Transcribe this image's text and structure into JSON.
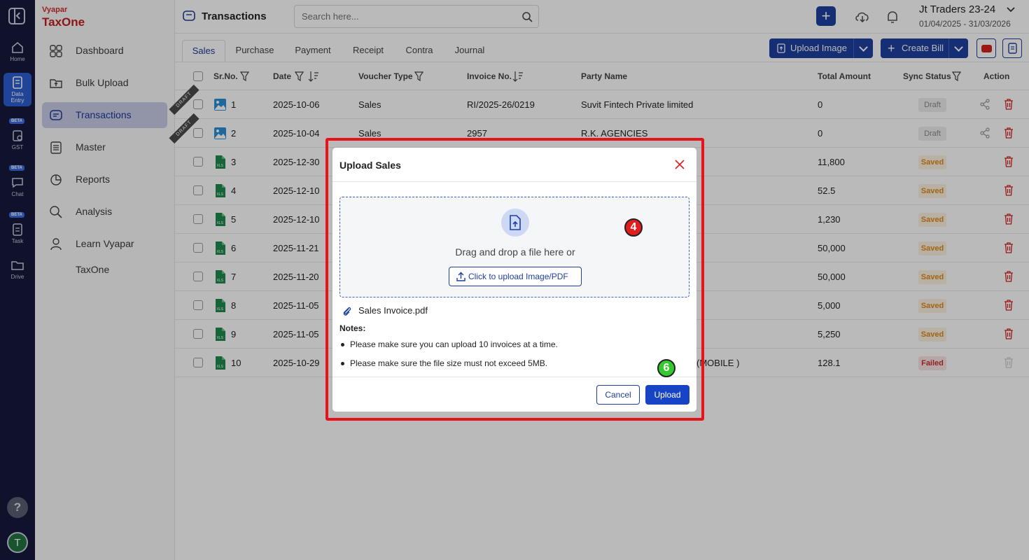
{
  "app": {
    "logo_line1": "Vyapar",
    "logo_line2": "TaxOne"
  },
  "rail": {
    "items": [
      {
        "label": "Home",
        "icon": "home-icon"
      },
      {
        "label": "Data Entry",
        "icon": "data-entry-icon",
        "active": true
      },
      {
        "label": "GST",
        "icon": "gst-icon",
        "badge": "BETA"
      },
      {
        "label": "Chat",
        "icon": "chat-icon",
        "badge": "BETA"
      },
      {
        "label": "Task",
        "icon": "task-icon",
        "badge": "BETA"
      },
      {
        "label": "Drive",
        "icon": "drive-icon"
      }
    ],
    "help": "?",
    "avatar": "T"
  },
  "sidebar": {
    "items": [
      {
        "label": "Dashboard",
        "icon": "dashboard-icon"
      },
      {
        "label": "Bulk Upload",
        "icon": "bulk-upload-icon"
      },
      {
        "label": "Transactions",
        "icon": "transactions-icon",
        "active": true
      },
      {
        "label": "Master",
        "icon": "master-icon"
      },
      {
        "label": "Reports",
        "icon": "reports-icon"
      },
      {
        "label": "Analysis",
        "icon": "analysis-icon"
      },
      {
        "label": "Learn Vyapar TaxOne",
        "icon": "learn-icon"
      }
    ]
  },
  "header": {
    "title": "Transactions",
    "search_placeholder": "Search here...",
    "company": "Jt Traders 23-24",
    "period": "01/04/2025 - 31/03/2026",
    "new_label": "+"
  },
  "tabs": [
    "Sales",
    "Purchase",
    "Payment",
    "Receipt",
    "Contra",
    "Journal"
  ],
  "actions": {
    "upload_image": "Upload Image",
    "create_bill": "Create Bill"
  },
  "table": {
    "columns": [
      "Sr.No.",
      "Date",
      "Voucher Type",
      "Invoice No.",
      "Party Name",
      "Total Amount",
      "Sync Status",
      "Action"
    ],
    "rows": [
      {
        "sr": "1",
        "date": "2025-10-06",
        "voucher": "Sales",
        "invoice": "RI/2025-26/0219",
        "party": "Suvit Fintech Private limited",
        "amount": "0",
        "status": "Draft",
        "kind": "image",
        "draft": true
      },
      {
        "sr": "2",
        "date": "2025-10-04",
        "voucher": "Sales",
        "invoice": "2957",
        "party": "R.K. AGENCIES",
        "amount": "0",
        "status": "Draft",
        "kind": "image",
        "draft": true
      },
      {
        "sr": "3",
        "date": "2025-12-30",
        "voucher": "",
        "invoice": "",
        "party": "",
        "amount": "11,800",
        "status": "Saved",
        "kind": "xls"
      },
      {
        "sr": "4",
        "date": "2025-12-10",
        "voucher": "",
        "invoice": "",
        "party": "",
        "amount": "52.5",
        "status": "Saved",
        "kind": "xls"
      },
      {
        "sr": "5",
        "date": "2025-12-10",
        "voucher": "",
        "invoice": "",
        "party": "",
        "amount": "1,230",
        "status": "Saved",
        "kind": "xls"
      },
      {
        "sr": "6",
        "date": "2025-11-21",
        "voucher": "",
        "invoice": "",
        "party": "",
        "amount": "50,000",
        "status": "Saved",
        "kind": "xls"
      },
      {
        "sr": "7",
        "date": "2025-11-20",
        "voucher": "",
        "invoice": "",
        "party": "",
        "amount": "50,000",
        "status": "Saved",
        "kind": "xls"
      },
      {
        "sr": "8",
        "date": "2025-11-05",
        "voucher": "",
        "invoice": "",
        "party": "",
        "amount": "5,000",
        "status": "Saved",
        "kind": "xls"
      },
      {
        "sr": "9",
        "date": "2025-11-05",
        "voucher": "",
        "invoice": "",
        "party": "",
        "amount": "5,250",
        "status": "Saved",
        "kind": "xls"
      },
      {
        "sr": "10",
        "date": "2025-10-29",
        "voucher": "",
        "invoice": "",
        "party": "(MOBILE )",
        "amount": "128.1",
        "status": "Failed",
        "kind": "xls"
      }
    ],
    "draft_ribbon": "DRAFT"
  },
  "modal": {
    "title": "Upload Sales",
    "drop_text": "Drag and drop a file here or",
    "upload_button": "Click to upload Image/PDF",
    "file_name": "Sales Invoice.pdf",
    "notes_title": "Notes:",
    "notes": [
      "Please make sure you can upload 10 invoices at a time.",
      "Please make sure the file size must not exceed 5MB."
    ],
    "cancel": "Cancel",
    "upload": "Upload"
  },
  "annotations": {
    "step_a": "4",
    "step_b": "6"
  },
  "colors": {
    "brand": "#1e3f9f",
    "highlight": "#e8131a",
    "saved": "#e0891d",
    "failed": "#c53030"
  }
}
